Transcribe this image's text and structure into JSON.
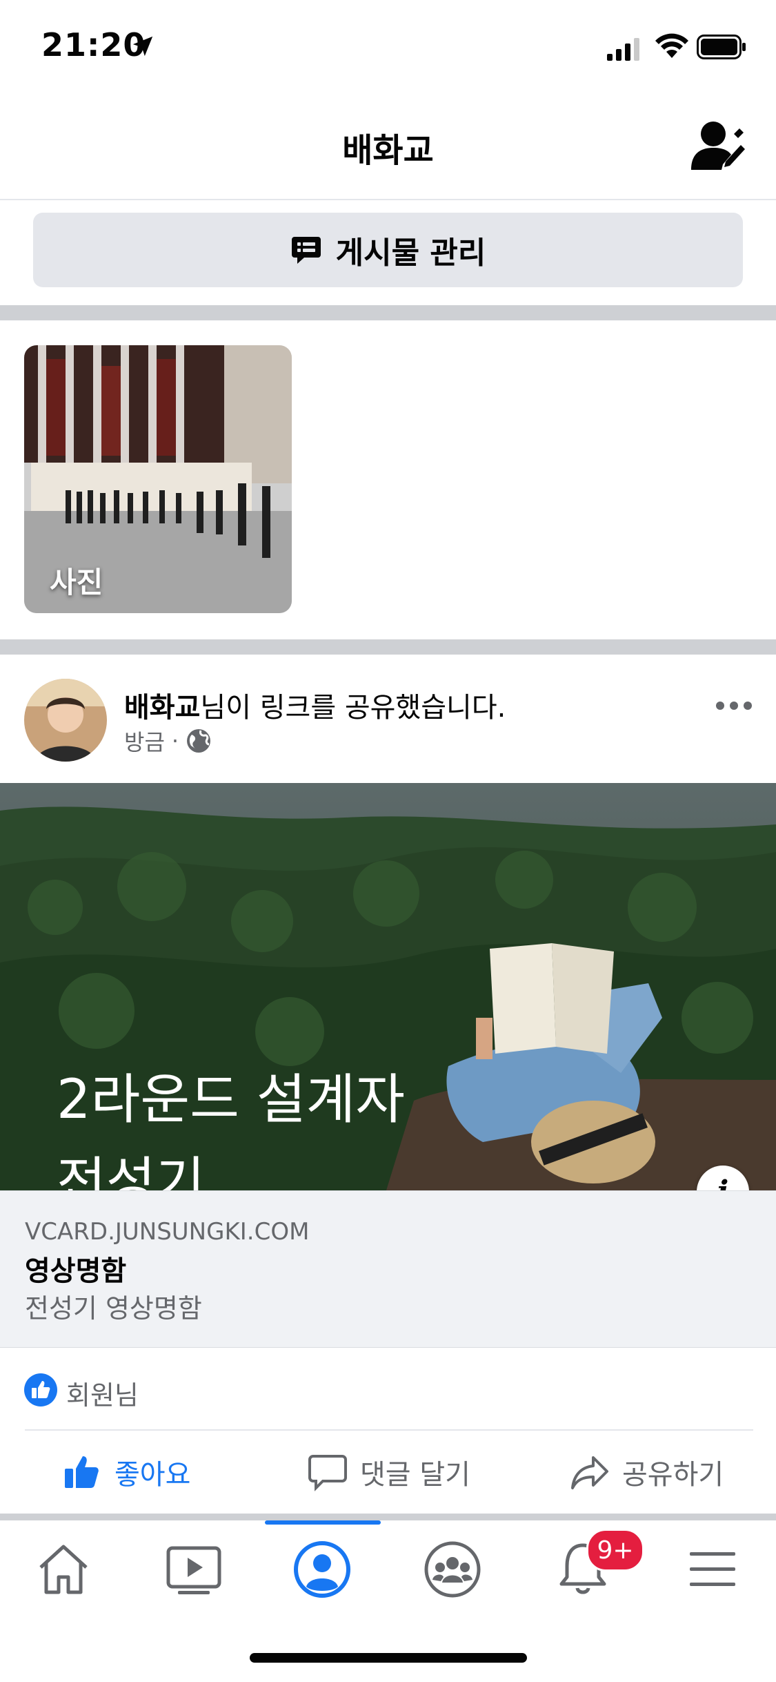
{
  "status_bar": {
    "time": "21:20"
  },
  "header": {
    "title": "배화교"
  },
  "manage_posts": {
    "label": "게시물 관리"
  },
  "photos_card": {
    "label": "사진"
  },
  "post": {
    "author": "배화교",
    "action_text": "님이 링크를 공유했습니다.",
    "time": "방금",
    "separator": "·"
  },
  "link_preview": {
    "image_text_line1": "2라운드 설계자",
    "image_text_line2": "전성기",
    "info_label": "i",
    "domain": "VCARD.JUNSUNGKI.COM",
    "title": "영상명함",
    "description": "전성기 영상명함"
  },
  "reactions": {
    "text": "회원님"
  },
  "actions": {
    "like_label": "좋아요",
    "comment_label": "댓글 달기",
    "share_label": "공유하기"
  },
  "tab_bar": {
    "tabs": [
      "home-icon",
      "watch-icon",
      "profile-icon",
      "groups-icon",
      "notifications-icon",
      "menu-icon"
    ],
    "active_tab": "profile-icon",
    "notification_badge": "9+"
  },
  "colors": {
    "accent": "#1877f2",
    "badge": "#e41e3f",
    "muted": "#65676b"
  }
}
